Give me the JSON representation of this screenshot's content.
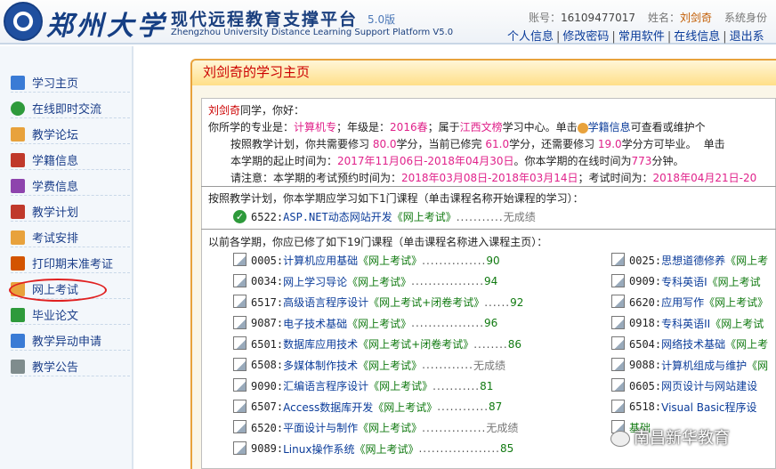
{
  "header": {
    "logo_text": "郑州大学",
    "platform_title": "现代远程教育支撑平台",
    "version": "5.0版",
    "subtitle": "Zhengzhou University Distance Learning Support Platform V5.0",
    "account_label": "账号：",
    "account_value": "16109477017",
    "name_label": "姓名：",
    "name_value": "刘剑奇",
    "role_label": "系统身份",
    "links": [
      "个人信息",
      "修改密码",
      "常用软件",
      "在线信息",
      "退出系"
    ],
    "link_sep": "|"
  },
  "sidebar": {
    "items": [
      {
        "label": "学习主页",
        "icon": "notebook-icon",
        "color": "#3a7bd5"
      },
      {
        "label": "在线即时交流",
        "icon": "chat-people-icon",
        "color": "#2e9a3b"
      },
      {
        "label": "教学论坛",
        "icon": "forum-icon",
        "color": "#e8a23c"
      },
      {
        "label": "学籍信息",
        "icon": "calendar-icon",
        "color": "#c0392b"
      },
      {
        "label": "学费信息",
        "icon": "books-icon",
        "color": "#8e44ad"
      },
      {
        "label": "教学计划",
        "icon": "calendar-plan-icon",
        "color": "#c0392b"
      },
      {
        "label": "考试安排",
        "icon": "exam-edit-icon",
        "color": "#e8a23c"
      },
      {
        "label": "打印期末准考证",
        "icon": "print-icon",
        "color": "#d35400"
      },
      {
        "label": "网上考试",
        "icon": "pen-icon",
        "color": "#e8a23c"
      },
      {
        "label": "毕业论文",
        "icon": "flag-icon",
        "color": "#2e9a3b"
      },
      {
        "label": "教学异动申请",
        "icon": "edit-doc-icon",
        "color": "#3a7bd5"
      },
      {
        "label": "教学公告",
        "icon": "announcement-icon",
        "color": "#7f8c8d"
      }
    ]
  },
  "main": {
    "title_name": "刘剑奇",
    "title_suffix": "的学习主页",
    "greeting": {
      "name": "刘剑奇",
      "hello": "同学，你好：",
      "l1_a": "你所学的专业是：",
      "major": "计算机专",
      "l1_b": "；年级是：",
      "grade": "2016春",
      "l1_c": "；属于",
      "center": "江西文榜",
      "l1_d": "学习中心。单击",
      "l1_link": "学籍信息",
      "l1_e": "可查看或维护个",
      "l2_a": "按照教学计划，你共需要修习 ",
      "need": "80.0",
      "l2_b": "学分，当前已修完 ",
      "done": "61.0",
      "l2_c": "学分，还需要修习 ",
      "remain": "19.0",
      "l2_d": "学分方可毕业。",
      "l2_e": "单击",
      "l3_a": "本学期的起止时间为：",
      "term": "2017年11月06日-2018年04月30日",
      "l3_b": "。你本学期的在线时间为",
      "online": "773",
      "l3_c": "分钟。",
      "l4_a": "请注意：本学期的考试预约时间为：",
      "reserve": "2018年03月08日-2018年03月14日",
      "l4_b": "；考试时间为：",
      "exam": "2018年04月21日-20"
    },
    "current_head": "按照教学计划，你本学期应学习如下1门课程（单击课程名称开始课程的学习）：",
    "current_courses": [
      {
        "code": "6522:",
        "name": "ASP.NET动态网站开发",
        "mode": "《网上考试》",
        "dots": "...........",
        "score": "无成绩"
      }
    ],
    "past_head": "以前各学期，你应已修了如下19门课程（单击课程名称进入课程主页）：",
    "past_left": [
      {
        "code": "0005:",
        "name": "计算机应用基础",
        "mode": "《网上考试》",
        "dots": "...............",
        "score": "90"
      },
      {
        "code": "0034:",
        "name": "网上学习导论",
        "mode": "《网上考试》",
        "dots": ".................",
        "score": "94"
      },
      {
        "code": "6517:",
        "name": "高级语言程序设计",
        "mode": "《网上考试+闭卷考试》",
        "dots": "......",
        "score": "92"
      },
      {
        "code": "9087:",
        "name": "电子技术基础",
        "mode": "《网上考试》",
        "dots": ".................",
        "score": "96"
      },
      {
        "code": "6501:",
        "name": "数据库应用技术",
        "mode": "《网上考试+闭卷考试》",
        "dots": "........",
        "score": "86"
      },
      {
        "code": "6508:",
        "name": "多媒体制作技术",
        "mode": "《网上考试》",
        "dots": "............",
        "score": "无成绩"
      },
      {
        "code": "9090:",
        "name": "汇编语言程序设计",
        "mode": "《网上考试》",
        "dots": "...........",
        "score": "81"
      },
      {
        "code": "6507:",
        "name": "Access数据库开发",
        "mode": "《网上考试》",
        "dots": "............",
        "score": "87"
      },
      {
        "code": "6520:",
        "name": "平面设计与制作",
        "mode": "《网上考试》",
        "dots": "...............",
        "score": "无成绩"
      },
      {
        "code": "9089:",
        "name": "Linux操作系统",
        "mode": "《网上考试》",
        "dots": "...................",
        "score": "85"
      }
    ],
    "past_right": [
      {
        "code": "0025:",
        "name": "思想道德修养",
        "mode": "《网上考"
      },
      {
        "code": "0909:",
        "name": "专科英语I",
        "mode": "《网上考试"
      },
      {
        "code": "6620:",
        "name": "应用写作",
        "mode": "《网上考试》"
      },
      {
        "code": "0918:",
        "name": "专科英语II",
        "mode": "《网上考试"
      },
      {
        "code": "6504:",
        "name": "网络技术基础",
        "mode": "《网上考"
      },
      {
        "code": "9088:",
        "name": "计算机组成与维护",
        "mode": "《网"
      },
      {
        "code": "0605:",
        "name": "网页设计与网站建设",
        "mode": ""
      },
      {
        "code": "6518:",
        "name": "Visual Basic程序设",
        "mode": ""
      },
      {
        "code": "",
        "name": "",
        "mode": "基础"
      }
    ]
  },
  "watermark": "南昌新华教育"
}
